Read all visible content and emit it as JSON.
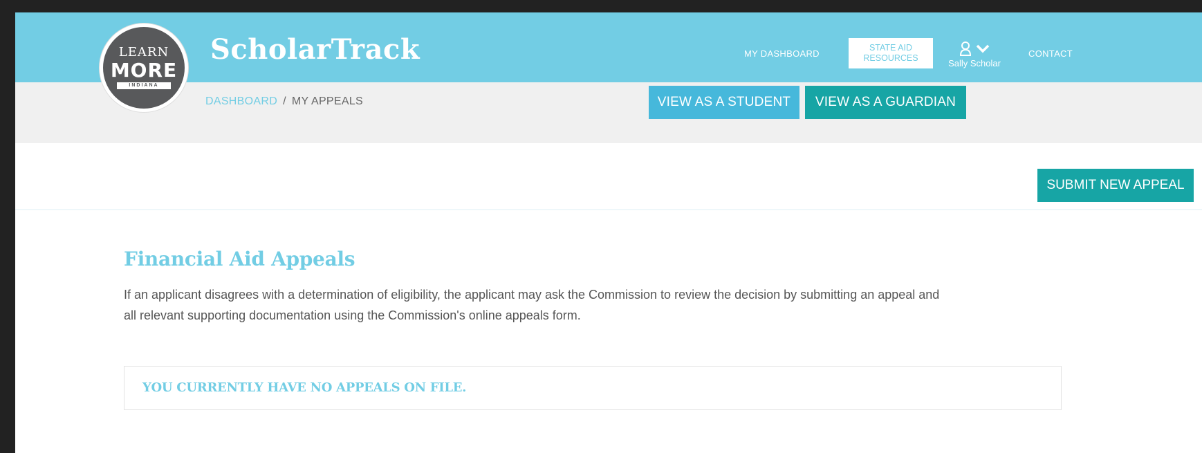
{
  "header": {
    "logo": {
      "top": "LEARN",
      "middle": "MORE",
      "band": "INDIANA"
    },
    "brand": "ScholarTrack",
    "nav": {
      "dashboard": "MY DASHBOARD",
      "state_aid_line1": "STATE AID",
      "state_aid_line2": "RESOURCES",
      "user_name": "Sally Scholar",
      "contact": "CONTACT"
    }
  },
  "subbar": {
    "breadcrumb": {
      "link": "DASHBOARD",
      "separator": "/",
      "current": "MY APPEALS"
    },
    "view_student": "VIEW AS A STUDENT",
    "view_guardian": "VIEW AS A GUARDIAN"
  },
  "actions": {
    "submit": "SUBMIT NEW APPEAL"
  },
  "main": {
    "title": "Financial Aid Appeals",
    "intro_line1": "If an applicant disagrees with a determination of eligibility, the applicant may ask the Commission to review the decision by submitting an appeal and",
    "intro_line2": "all relevant supporting documentation using the Commission's online appeals form.",
    "empty_state": "YOU CURRENTLY HAVE NO APPEALS ON FILE."
  },
  "colors": {
    "header_bg": "#72cde4",
    "subbar_bg": "#f0f0f0",
    "student_button": "#46b8db",
    "guardian_button": "#17a5a5",
    "submit_button": "#17a5a5",
    "title_color": "#72cde4"
  },
  "icons": {
    "user": "user-icon",
    "chevron": "chevron-down-icon"
  }
}
